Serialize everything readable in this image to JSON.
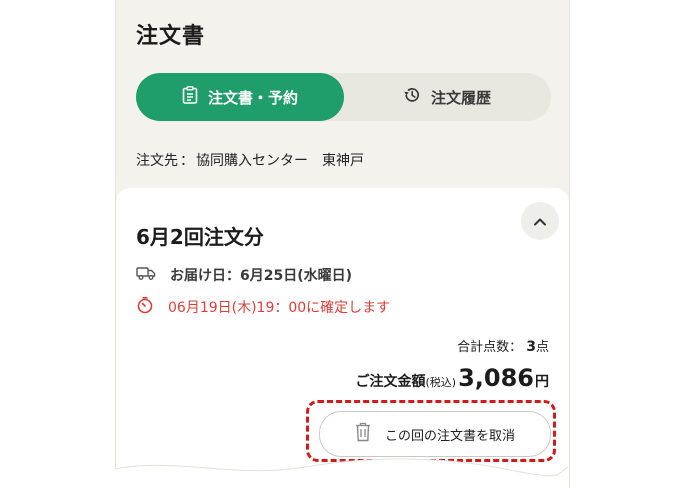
{
  "header": {
    "title": "注文書"
  },
  "tabs": [
    {
      "label": "注文書・予約",
      "icon": "clipboard-icon",
      "active": true
    },
    {
      "label": "注文履歴",
      "icon": "history-icon",
      "active": false
    }
  ],
  "order_destination": {
    "label": "注文先",
    "separator": "：",
    "center": "協同購入センター",
    "place": "東神戸"
  },
  "order_card": {
    "title": "6月2回注文分",
    "delivery": {
      "label": "お届け日：6月25日(水曜日)",
      "icon": "delivery-truck-icon"
    },
    "deadline": {
      "label": "06月19日(木)19：00に確定します",
      "icon": "timer-icon"
    },
    "count": {
      "label": "合計点数：",
      "value": "3",
      "unit": "点"
    },
    "total": {
      "label": "ご注文金額",
      "tax_note": "(税込)",
      "value": "3,086",
      "unit": "円"
    },
    "cancel_button": {
      "label": "この回の注文書を取消",
      "icon": "trash-icon"
    }
  },
  "colors": {
    "primary": "#1f9d6b",
    "deadline": "#d9403a",
    "highlight": "#d21a1a",
    "background": "#f3f2ed"
  }
}
